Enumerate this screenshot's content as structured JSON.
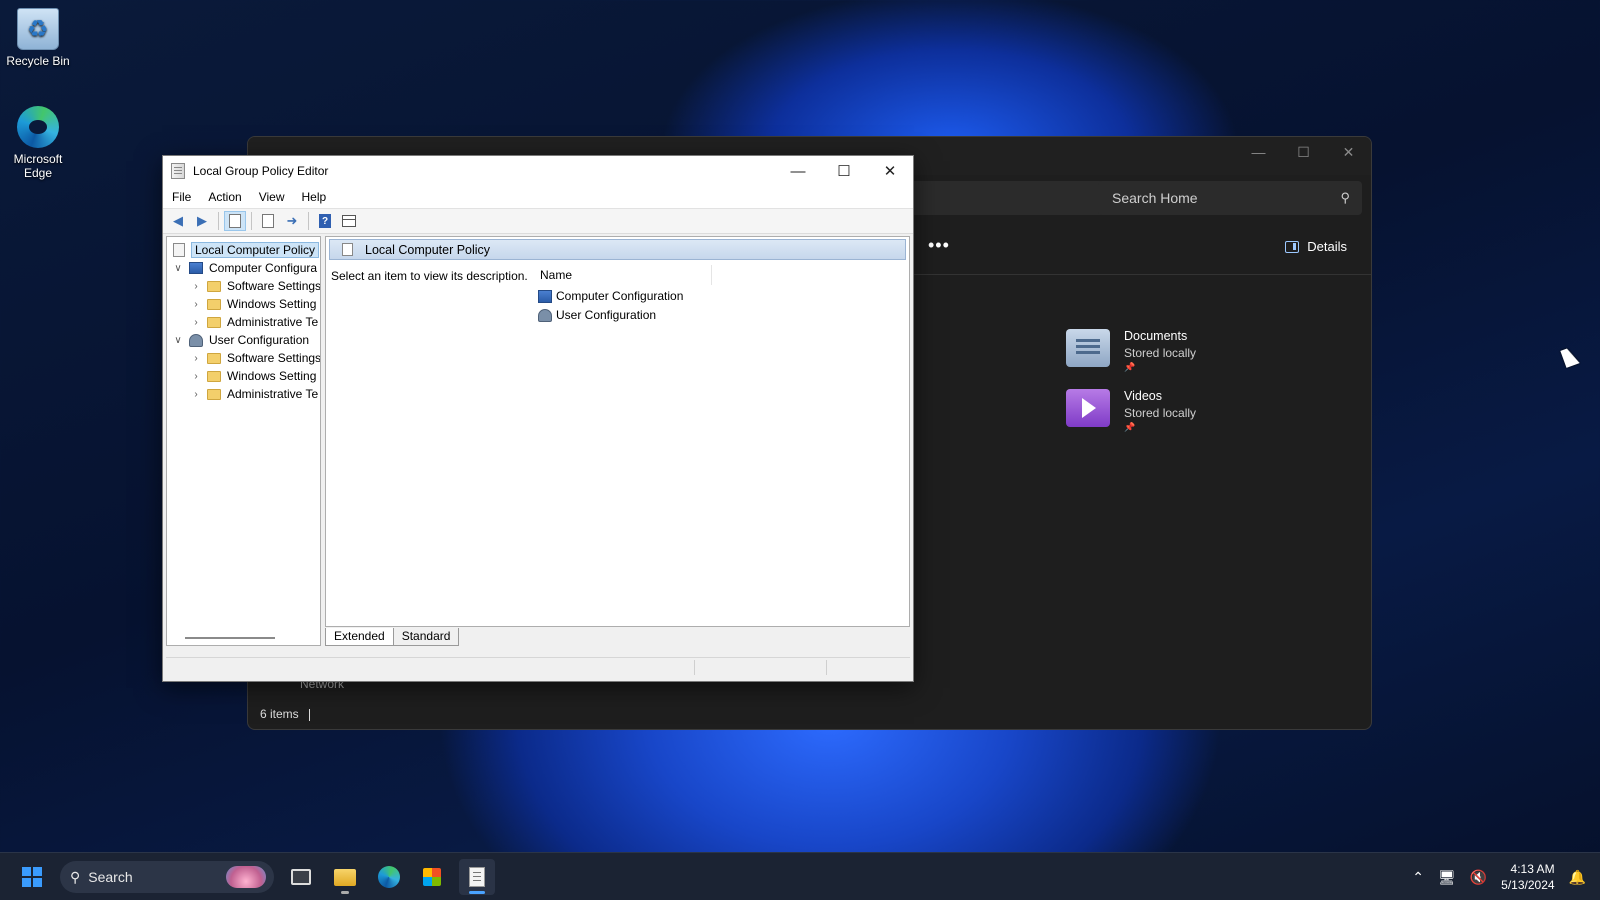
{
  "desktop": {
    "icons": [
      {
        "label": "Recycle Bin",
        "icon": "recycle-bin-icon"
      },
      {
        "label": "Microsoft Edge",
        "icon": "edge-icon"
      }
    ]
  },
  "explorer": {
    "search_placeholder": "Search Home",
    "more_label": "•••",
    "details_label": "Details",
    "quick_access": [
      {
        "name": "Documents",
        "location": "Stored locally",
        "icon": "documents-folder-icon"
      },
      {
        "name": "Videos",
        "location": "Stored locally",
        "icon": "videos-folder-icon"
      }
    ],
    "nav_network": "Network",
    "status_items": "6 items"
  },
  "gpedit": {
    "title": "Local Group Policy Editor",
    "menu": [
      "File",
      "Action",
      "View",
      "Help"
    ],
    "tree": {
      "root": "Local Computer Policy",
      "computer_config": "Computer Configura",
      "computer_children": [
        "Software Settings",
        "Windows Setting",
        "Administrative Te"
      ],
      "user_config": "User Configuration",
      "user_children": [
        "Software Settings",
        "Windows Setting",
        "Administrative Te"
      ]
    },
    "detail": {
      "header": "Local Computer Policy",
      "description": "Select an item to view its description.",
      "column_name": "Name",
      "items": [
        "Computer Configuration",
        "User Configuration"
      ]
    },
    "tabs": [
      "Extended",
      "Standard"
    ],
    "active_tab": "Extended"
  },
  "taskbar": {
    "search_label": "Search",
    "time": "4:13 AM",
    "date": "5/13/2024",
    "accent": "#4aa3ff"
  }
}
